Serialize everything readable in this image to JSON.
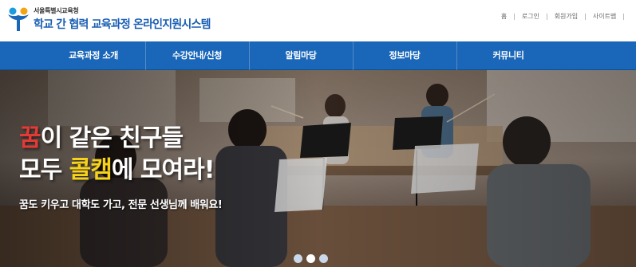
{
  "logo": {
    "org": "서울특별시교육청",
    "title": "학교 간 협력 교육과정 온라인지원시스템"
  },
  "util_nav": {
    "home": "홈",
    "login": "로그인",
    "signup": "회원가입",
    "sitemap": "사이트맵",
    "separator": "|"
  },
  "gnb": [
    {
      "label": "교육과정 소개"
    },
    {
      "label": "수강안내/신청"
    },
    {
      "label": "알림마당"
    },
    {
      "label": "정보마당"
    },
    {
      "label": "커뮤니티"
    }
  ],
  "hero": {
    "line1": {
      "a": "꿈",
      "b": "이 같은 친구들"
    },
    "line2": {
      "a": "모두 ",
      "b": "콜캠",
      "c": "에 모여라!"
    },
    "sub": "꿈도 키우고 대학도 가고, 전문 선생님께 배워요!"
  },
  "slider": {
    "count": 3,
    "active": 1
  },
  "colors": {
    "brand_blue": "#1a66b8",
    "accent_red": "#e53935",
    "accent_yellow": "#f6d21a"
  }
}
